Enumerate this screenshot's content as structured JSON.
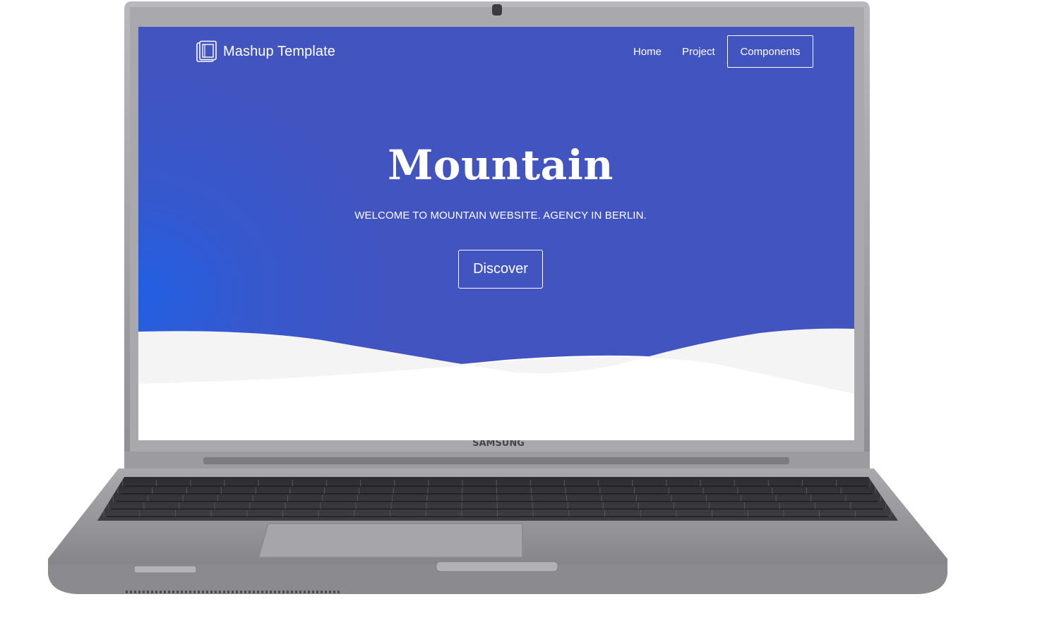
{
  "site": {
    "brand": "Mashup Template",
    "brand_icon": "book-stack-icon"
  },
  "nav": {
    "home": "Home",
    "project": "Project",
    "components": "Components"
  },
  "hero": {
    "title": "Mountain",
    "subtitle": "WELCOME TO MOUNTAIN WEBSITE. AGENCY IN BERLIN.",
    "cta": "Discover"
  },
  "device": {
    "brand_label": "SAMSUNG"
  },
  "colors": {
    "hero_background": "#4254c0",
    "hero_accent": "#2060e6",
    "wave_light": "#f4f4f5",
    "text": "#ffffff"
  }
}
